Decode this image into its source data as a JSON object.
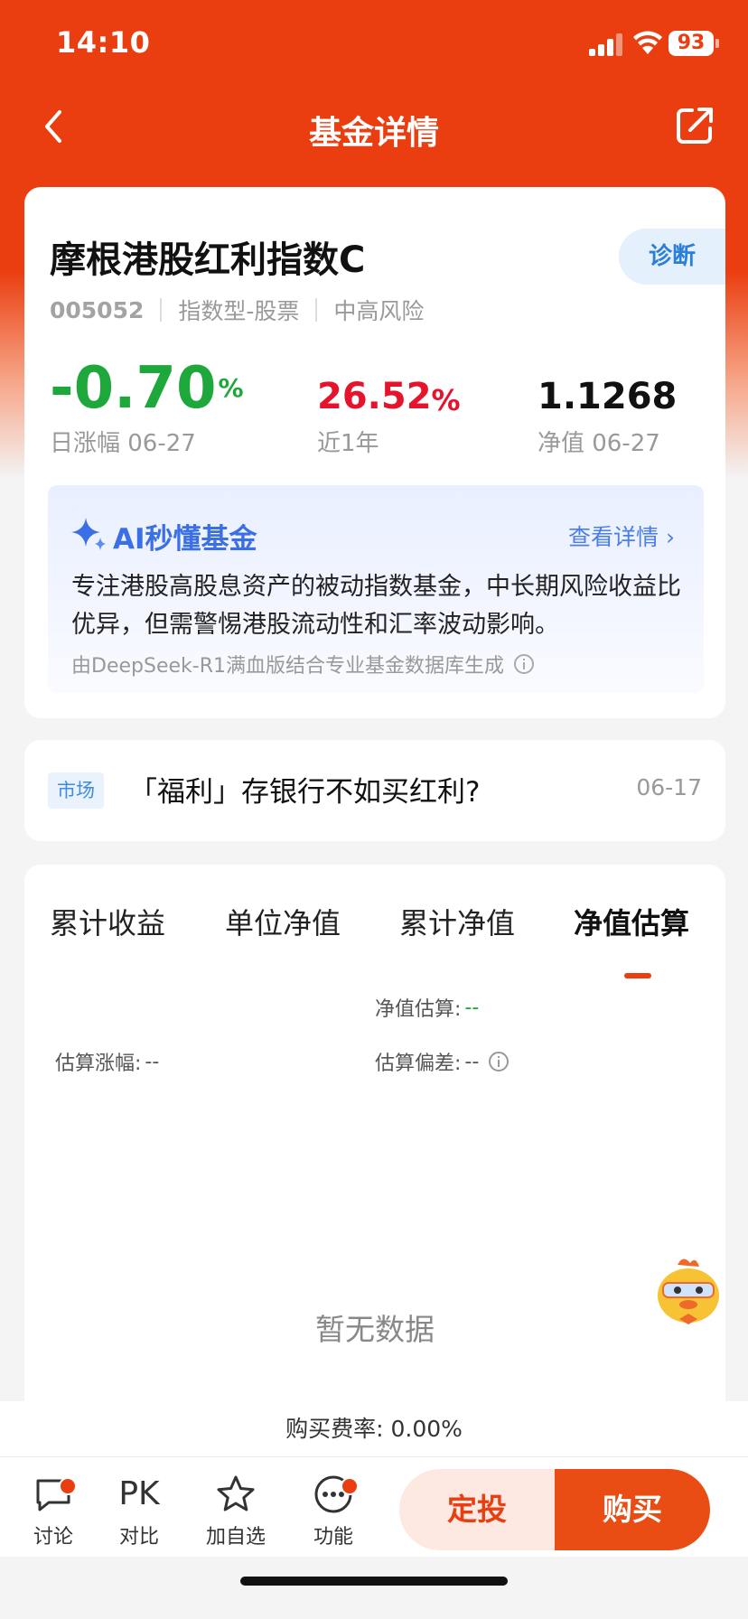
{
  "status_bar": {
    "time": "14:10",
    "battery": "93"
  },
  "nav": {
    "title": "基金详情",
    "back_icon": "chevron-left-icon",
    "share_icon": "share-icon"
  },
  "fund": {
    "name": "摩根港股红利指数C",
    "diagnose_label": "诊断",
    "code": "005052",
    "type": "指数型-股票",
    "risk": "中高风险",
    "day_change": {
      "value": "-0.70",
      "unit": "%",
      "label": "日涨幅 06-27",
      "color": "#1ea83c"
    },
    "year_return": {
      "value": "26.52",
      "unit": "%",
      "label": "近1年",
      "color": "#e5142c"
    },
    "nav_value": {
      "value": "1.1268",
      "label": "净值 06-27"
    }
  },
  "ai": {
    "title": "AI秒懂基金",
    "more_label": "查看详情",
    "summary": "专注港股高股息资产的被动指数基金，中长期风险收益比优异，但需警惕港股流动性和汇率波动影响。",
    "source": "由DeepSeek-R1满血版结合专业基金数据库生成"
  },
  "news": {
    "tag": "市场",
    "title": "「福利」存银行不如买红利?",
    "date": "06-17"
  },
  "chart": {
    "tabs": [
      {
        "label": "累计收益"
      },
      {
        "label": "单位净值"
      },
      {
        "label": "累计净值"
      },
      {
        "label": "净值估算"
      }
    ],
    "active_tab": 3,
    "estimate_nav_label": "净值估算:",
    "estimate_nav_value": "--",
    "estimate_change_label": "估算涨幅:",
    "estimate_change_value": "--",
    "estimate_dev_label": "估算偏差:",
    "estimate_dev_value": "--",
    "empty_text": "暂无数据"
  },
  "fee": {
    "text": "购买费率: 0.00%"
  },
  "bottom_bar": {
    "items": [
      {
        "label": "讨论",
        "icon": "chat-bubble-icon"
      },
      {
        "label": "对比",
        "icon": "PK"
      },
      {
        "label": "加自选",
        "icon": "star-icon"
      },
      {
        "label": "功能",
        "icon": "more-dots-icon"
      }
    ],
    "fixed_invest_label": "定投",
    "buy_label": "购买"
  },
  "colors": {
    "brand": "#ea3e10",
    "rise": "#e5142c",
    "fall": "#1ea83c",
    "link": "#2d7ed6"
  }
}
